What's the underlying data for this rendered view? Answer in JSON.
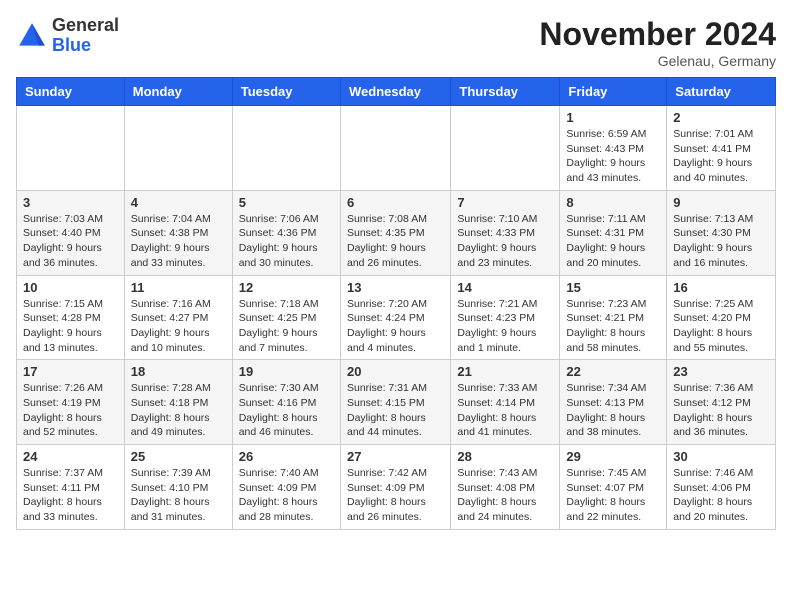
{
  "header": {
    "logo": {
      "general": "General",
      "blue": "Blue"
    },
    "title": "November 2024",
    "location": "Gelenau, Germany"
  },
  "days_of_week": [
    "Sunday",
    "Monday",
    "Tuesday",
    "Wednesday",
    "Thursday",
    "Friday",
    "Saturday"
  ],
  "weeks": [
    [
      {
        "day": "",
        "info": ""
      },
      {
        "day": "",
        "info": ""
      },
      {
        "day": "",
        "info": ""
      },
      {
        "day": "",
        "info": ""
      },
      {
        "day": "",
        "info": ""
      },
      {
        "day": "1",
        "info": "Sunrise: 6:59 AM\nSunset: 4:43 PM\nDaylight: 9 hours\nand 43 minutes."
      },
      {
        "day": "2",
        "info": "Sunrise: 7:01 AM\nSunset: 4:41 PM\nDaylight: 9 hours\nand 40 minutes."
      }
    ],
    [
      {
        "day": "3",
        "info": "Sunrise: 7:03 AM\nSunset: 4:40 PM\nDaylight: 9 hours\nand 36 minutes."
      },
      {
        "day": "4",
        "info": "Sunrise: 7:04 AM\nSunset: 4:38 PM\nDaylight: 9 hours\nand 33 minutes."
      },
      {
        "day": "5",
        "info": "Sunrise: 7:06 AM\nSunset: 4:36 PM\nDaylight: 9 hours\nand 30 minutes."
      },
      {
        "day": "6",
        "info": "Sunrise: 7:08 AM\nSunset: 4:35 PM\nDaylight: 9 hours\nand 26 minutes."
      },
      {
        "day": "7",
        "info": "Sunrise: 7:10 AM\nSunset: 4:33 PM\nDaylight: 9 hours\nand 23 minutes."
      },
      {
        "day": "8",
        "info": "Sunrise: 7:11 AM\nSunset: 4:31 PM\nDaylight: 9 hours\nand 20 minutes."
      },
      {
        "day": "9",
        "info": "Sunrise: 7:13 AM\nSunset: 4:30 PM\nDaylight: 9 hours\nand 16 minutes."
      }
    ],
    [
      {
        "day": "10",
        "info": "Sunrise: 7:15 AM\nSunset: 4:28 PM\nDaylight: 9 hours\nand 13 minutes."
      },
      {
        "day": "11",
        "info": "Sunrise: 7:16 AM\nSunset: 4:27 PM\nDaylight: 9 hours\nand 10 minutes."
      },
      {
        "day": "12",
        "info": "Sunrise: 7:18 AM\nSunset: 4:25 PM\nDaylight: 9 hours\nand 7 minutes."
      },
      {
        "day": "13",
        "info": "Sunrise: 7:20 AM\nSunset: 4:24 PM\nDaylight: 9 hours\nand 4 minutes."
      },
      {
        "day": "14",
        "info": "Sunrise: 7:21 AM\nSunset: 4:23 PM\nDaylight: 9 hours\nand 1 minute."
      },
      {
        "day": "15",
        "info": "Sunrise: 7:23 AM\nSunset: 4:21 PM\nDaylight: 8 hours\nand 58 minutes."
      },
      {
        "day": "16",
        "info": "Sunrise: 7:25 AM\nSunset: 4:20 PM\nDaylight: 8 hours\nand 55 minutes."
      }
    ],
    [
      {
        "day": "17",
        "info": "Sunrise: 7:26 AM\nSunset: 4:19 PM\nDaylight: 8 hours\nand 52 minutes."
      },
      {
        "day": "18",
        "info": "Sunrise: 7:28 AM\nSunset: 4:18 PM\nDaylight: 8 hours\nand 49 minutes."
      },
      {
        "day": "19",
        "info": "Sunrise: 7:30 AM\nSunset: 4:16 PM\nDaylight: 8 hours\nand 46 minutes."
      },
      {
        "day": "20",
        "info": "Sunrise: 7:31 AM\nSunset: 4:15 PM\nDaylight: 8 hours\nand 44 minutes."
      },
      {
        "day": "21",
        "info": "Sunrise: 7:33 AM\nSunset: 4:14 PM\nDaylight: 8 hours\nand 41 minutes."
      },
      {
        "day": "22",
        "info": "Sunrise: 7:34 AM\nSunset: 4:13 PM\nDaylight: 8 hours\nand 38 minutes."
      },
      {
        "day": "23",
        "info": "Sunrise: 7:36 AM\nSunset: 4:12 PM\nDaylight: 8 hours\nand 36 minutes."
      }
    ],
    [
      {
        "day": "24",
        "info": "Sunrise: 7:37 AM\nSunset: 4:11 PM\nDaylight: 8 hours\nand 33 minutes."
      },
      {
        "day": "25",
        "info": "Sunrise: 7:39 AM\nSunset: 4:10 PM\nDaylight: 8 hours\nand 31 minutes."
      },
      {
        "day": "26",
        "info": "Sunrise: 7:40 AM\nSunset: 4:09 PM\nDaylight: 8 hours\nand 28 minutes."
      },
      {
        "day": "27",
        "info": "Sunrise: 7:42 AM\nSunset: 4:09 PM\nDaylight: 8 hours\nand 26 minutes."
      },
      {
        "day": "28",
        "info": "Sunrise: 7:43 AM\nSunset: 4:08 PM\nDaylight: 8 hours\nand 24 minutes."
      },
      {
        "day": "29",
        "info": "Sunrise: 7:45 AM\nSunset: 4:07 PM\nDaylight: 8 hours\nand 22 minutes."
      },
      {
        "day": "30",
        "info": "Sunrise: 7:46 AM\nSunset: 4:06 PM\nDaylight: 8 hours\nand 20 minutes."
      }
    ]
  ]
}
